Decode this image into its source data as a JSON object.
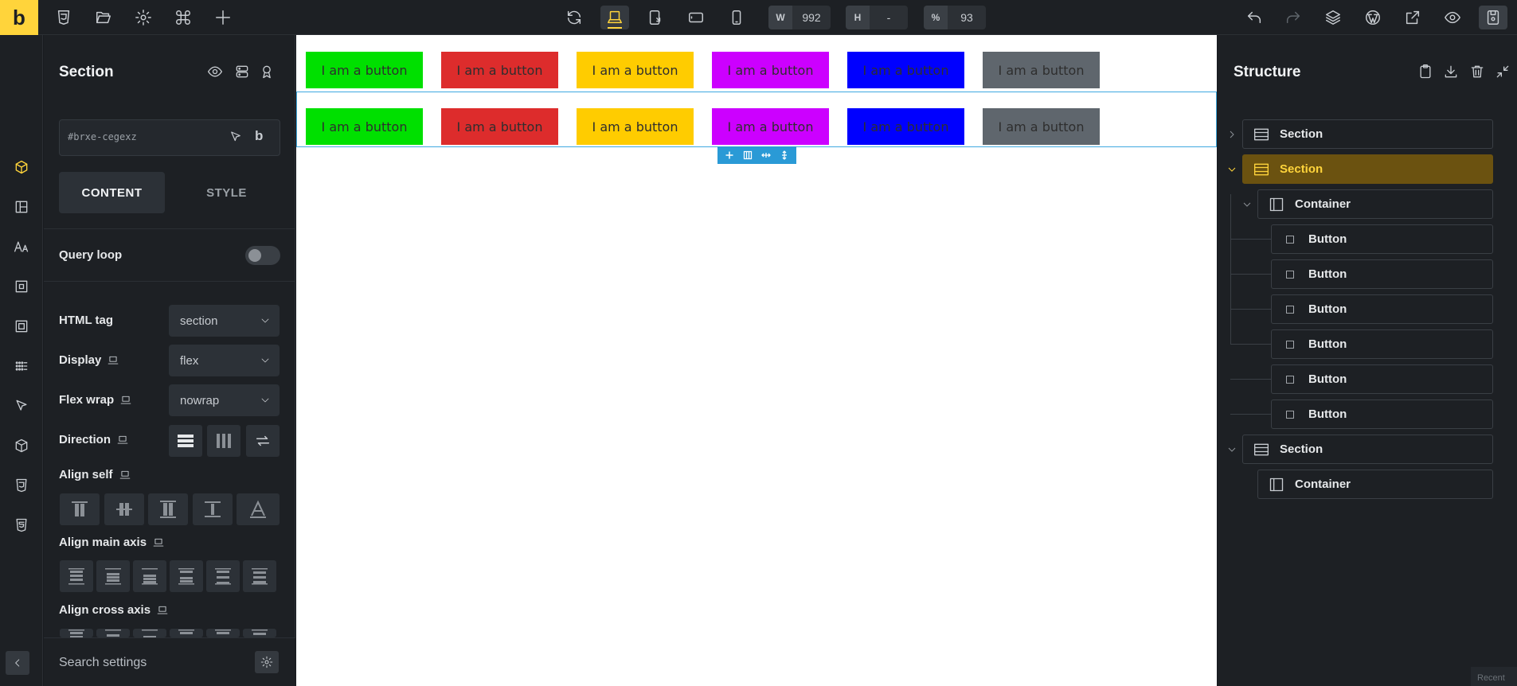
{
  "app": {
    "logo_letter": "b",
    "accent": "#ffd43b"
  },
  "topbar": {
    "width_label": "W",
    "width_value": "992",
    "height_label": "H",
    "height_value": "-",
    "zoom_label": "%",
    "zoom_value": "93"
  },
  "panel": {
    "title": "Section",
    "element_id": "#brxe-cegexz",
    "tabs": {
      "content": "CONTENT",
      "style": "STYLE"
    },
    "query_loop": "Query loop",
    "html_tag": {
      "label": "HTML tag",
      "value": "section"
    },
    "display": {
      "label": "Display",
      "value": "flex"
    },
    "flex_wrap": {
      "label": "Flex wrap",
      "value": "nowrap"
    },
    "direction": "Direction",
    "align_self": "Align self",
    "align_main_axis": "Align main axis",
    "align_cross_axis": "Align cross axis",
    "search_settings": "Search settings"
  },
  "canvas": {
    "button_label": "I am a button",
    "button_colors": [
      "#00e000",
      "#dd2c2c",
      "#ffcc00",
      "#cc00ff",
      "#0000ff",
      "#5f666d"
    ]
  },
  "structure": {
    "title": "Structure",
    "nodes": [
      {
        "label": "Section",
        "type": "section"
      },
      {
        "label": "Section",
        "type": "section",
        "active": true
      },
      {
        "label": "Container",
        "type": "container"
      },
      {
        "label": "Button",
        "type": "button"
      },
      {
        "label": "Button",
        "type": "button"
      },
      {
        "label": "Button",
        "type": "button"
      },
      {
        "label": "Button",
        "type": "button"
      },
      {
        "label": "Button",
        "type": "button"
      },
      {
        "label": "Button",
        "type": "button"
      },
      {
        "label": "Section",
        "type": "section"
      },
      {
        "label": "Container",
        "type": "container"
      }
    ]
  },
  "footer": {
    "recent": "Recent"
  }
}
